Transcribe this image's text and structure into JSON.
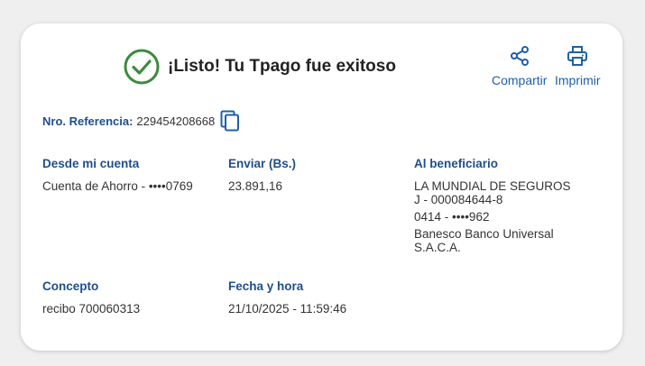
{
  "header": {
    "title": "¡Listo! Tu Tpago fue exitoso",
    "share_label": "Compartir",
    "print_label": "Imprimir"
  },
  "reference": {
    "label": "Nro. Referencia:",
    "value": "229454208668"
  },
  "fields": {
    "from_account": {
      "label": "Desde mi cuenta",
      "value": "Cuenta de Ahorro - ••••0769"
    },
    "amount": {
      "label": "Enviar (Bs.)",
      "value": "23.891,16"
    },
    "beneficiary": {
      "label": "Al beneficiario",
      "name": "LA MUNDIAL DE SEGUROS",
      "id": "J - 000084644-8",
      "phone": "0414 - ••••962",
      "bank_line1": "Banesco Banco Universal",
      "bank_line2": "S.A.C.A."
    },
    "concept": {
      "label": "Concepto",
      "value": "recibo 700060313"
    },
    "datetime": {
      "label": "Fecha y hora",
      "value": "21/10/2025 - 11:59:46"
    }
  },
  "icons": {
    "success": "check-circle-icon",
    "share": "share-icon",
    "print": "printer-icon",
    "copy": "copy-icon"
  },
  "colors": {
    "success_green": "#3c8a3e",
    "accent_blue": "#1f5fa8",
    "label_blue": "#1f4f8a"
  }
}
